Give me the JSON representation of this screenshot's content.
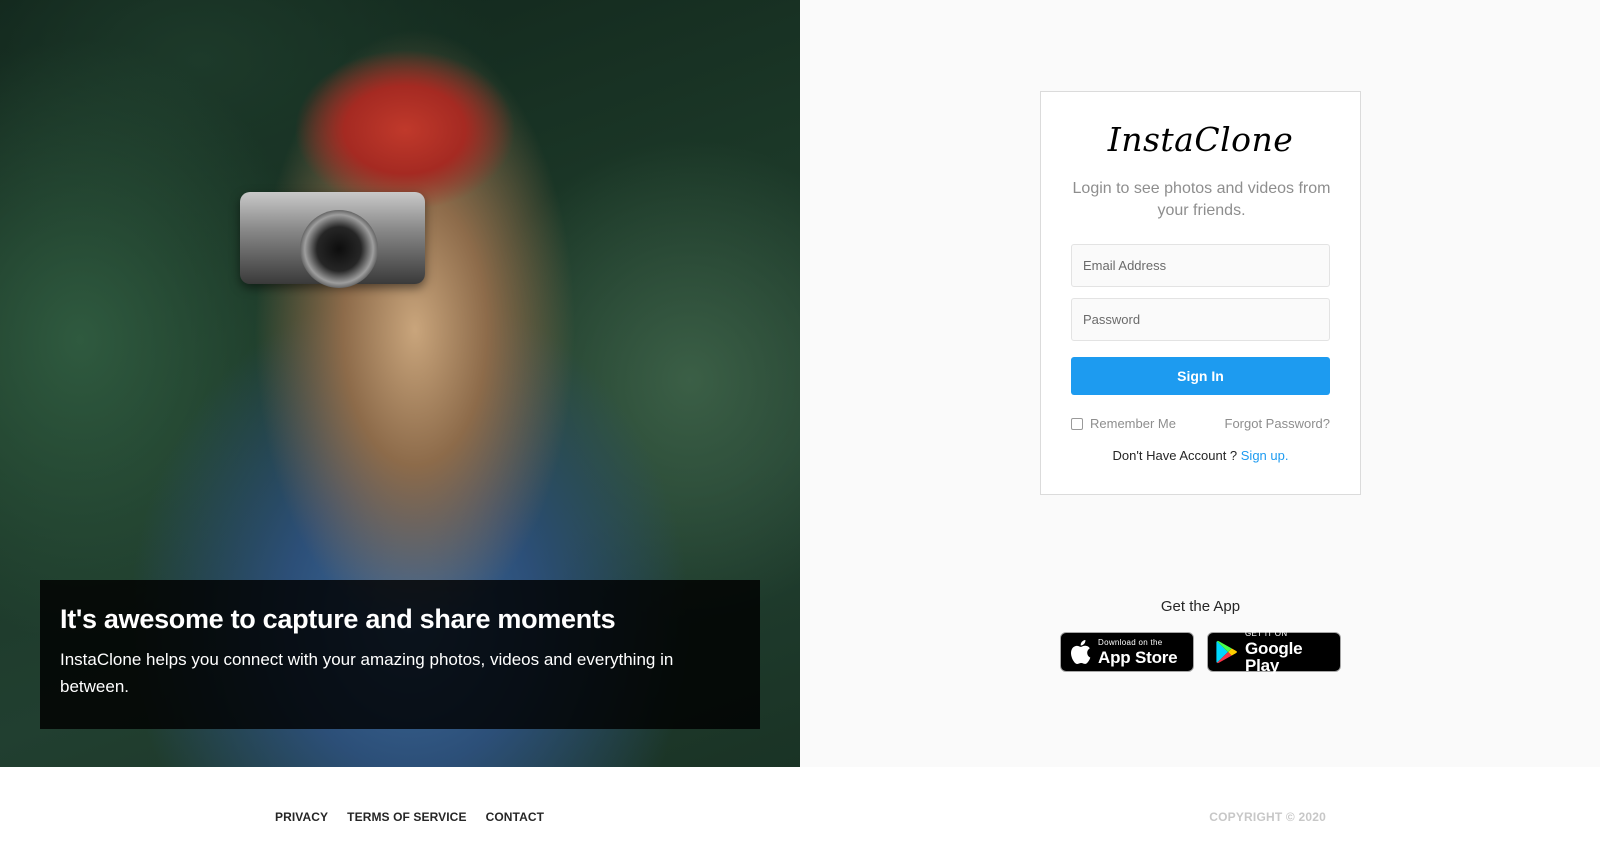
{
  "hero": {
    "headline": "It's awesome to capture and share moments",
    "description": "InstaClone helps you connect with your amazing photos, videos and everything in between."
  },
  "login": {
    "logo": "InstaClone",
    "subtitle": "Login to see photos and videos from your friends.",
    "email_placeholder": "Email Address",
    "password_placeholder": "Password",
    "signin_label": "Sign In",
    "remember_label": "Remember Me",
    "remember_checked": false,
    "forgot_label": "Forgot Password?",
    "no_account_text": "Don't Have Account ? ",
    "signup_label": "Sign up."
  },
  "app": {
    "title": "Get the App",
    "appstore_small": "Download on the",
    "appstore_big": "App Store",
    "googleplay_small": "GET IT ON",
    "googleplay_big": "Google Play"
  },
  "footer": {
    "links": [
      "PRIVACY",
      "TERMS OF SERVICE",
      "CONTACT"
    ],
    "copyright": "COPYRIGHT © 2020"
  },
  "colors": {
    "accent": "#1d9bf0",
    "background": "#fafafa",
    "caption_bg": "#000000"
  }
}
